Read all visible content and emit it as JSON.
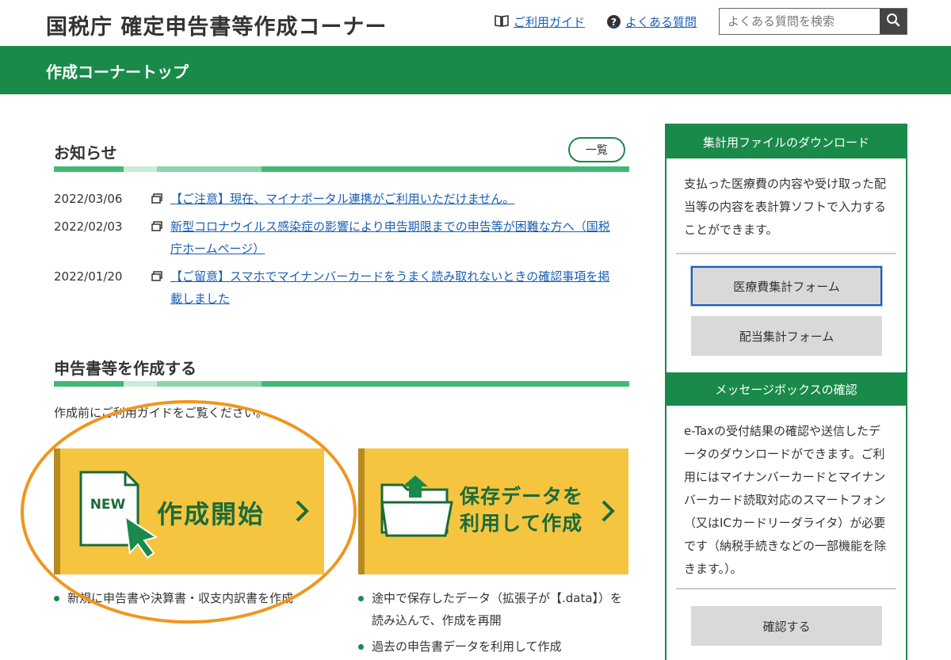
{
  "header": {
    "site_title": "国税庁 確定申告書等作成コーナー",
    "guide_link": "ご利用ガイド",
    "faq_link": "よくある質問",
    "search_placeholder": "よくある質問を検索"
  },
  "nav": {
    "title": "作成コーナートップ"
  },
  "news": {
    "title": "お知らせ",
    "list_button": "一覧",
    "items": [
      {
        "date": "2022/03/06",
        "text": "【ご注意】現在、マイナポータル連携がご利用いただけません。"
      },
      {
        "date": "2022/02/03",
        "text": "新型コロナウイルス感染症の影響により申告期限までの申告等が困難な方へ（国税庁ホームページ）"
      },
      {
        "date": "2022/01/20",
        "text": "【ご留意】スマホでマイナンバーカードをうまく読み取れないときの確認事項を掲載しました"
      }
    ]
  },
  "create": {
    "title": "申告書等を作成する",
    "intro": "作成前にご利用ガイドをご覧ください。",
    "new_button": {
      "badge": "NEW",
      "label": "作成開始",
      "bullets": [
        "新規に申告書や決算書・収支内訳書を作成"
      ]
    },
    "saved_button": {
      "label_line1": "保存データを",
      "label_line2": "利用して作成",
      "bullets": [
        "途中で保存したデータ（拡張子が【.data】）を読み込んで、作成を再開",
        "過去の申告書データを利用して作成"
      ]
    }
  },
  "sidebar": {
    "download": {
      "title": "集計用ファイルのダウンロード",
      "text": "支払った医療費の内容や受け取った配当等の内容を表計算ソフトで入力することができます。",
      "medical_button": "医療費集計フォーム",
      "dividend_button": "配当集計フォーム"
    },
    "message": {
      "title": "メッセージボックスの確認",
      "text": "e-Taxの受付結果の確認や送信したデータのダウンロードができます。ご利用にはマイナンバーカードとマイナンバーカード読取対応のスマートフォン（又はICカードリーダライタ）が必要です（納税手続きなどの一部機能を除きます。）。",
      "confirm_button": "確認する"
    }
  },
  "colors": {
    "brand_green": "#1a8a4a",
    "button_yellow": "#f6c53f",
    "highlight_orange": "#f0961e",
    "link_blue": "#1a5fb4"
  }
}
